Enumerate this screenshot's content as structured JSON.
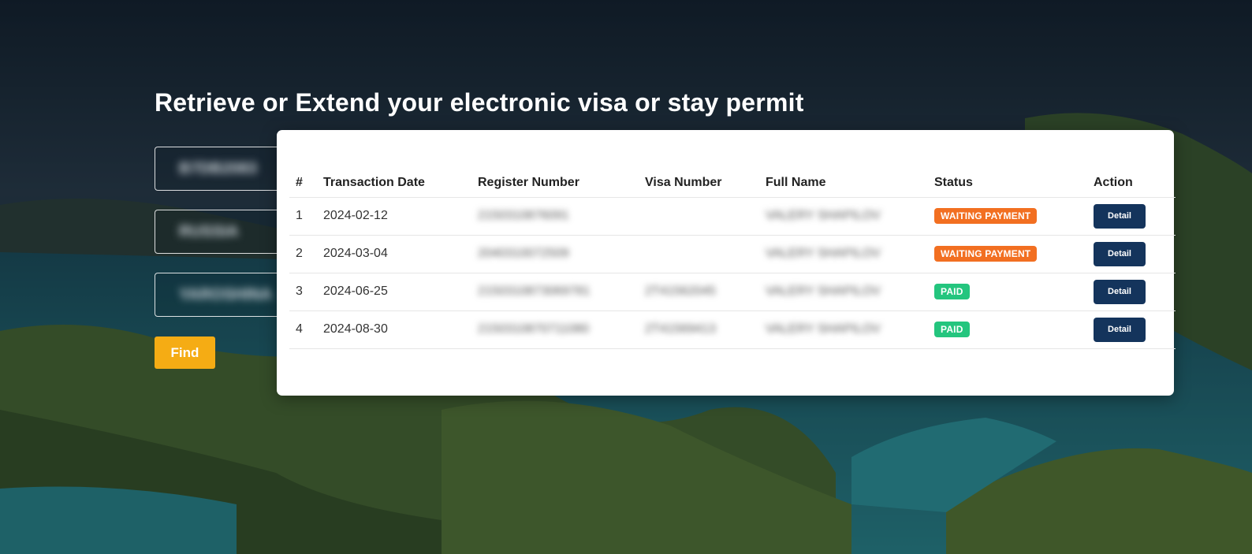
{
  "page": {
    "title": "Retrieve or Extend your electronic visa or stay permit"
  },
  "form": {
    "fields": [
      {
        "value": "B7DB2083"
      },
      {
        "value": "RUSSIA"
      },
      {
        "value": "YAROSHINA"
      }
    ],
    "find_label": "Find"
  },
  "table": {
    "headers": [
      "#",
      "Transaction Date",
      "Register Number",
      "Visa Number",
      "Full Name",
      "Status",
      "Action"
    ],
    "rows": [
      {
        "num": "1",
        "date": "2024-02-12",
        "register": "2150310876091",
        "visa": "",
        "name": "VALERY SHAPILOV",
        "status": "WAITING PAYMENT",
        "action": "Detail"
      },
      {
        "num": "2",
        "date": "2024-03-04",
        "register": "2040310072509",
        "visa": "",
        "name": "VALERY SHAPILOV",
        "status": "WAITING PAYMENT",
        "action": "Detail"
      },
      {
        "num": "3",
        "date": "2024-06-25",
        "register": "2150310873069781",
        "visa": "2T41562045",
        "name": "VALERY SHAPILOV",
        "status": "PAID",
        "action": "Detail"
      },
      {
        "num": "4",
        "date": "2024-08-30",
        "register": "2150310870711080",
        "visa": "2T41569413",
        "name": "VALERY SHAPILOV",
        "status": "PAID",
        "action": "Detail"
      }
    ]
  },
  "colors": {
    "waiting": "#f26f21",
    "paid": "#24c57e",
    "detail_button": "#14345c",
    "find_button": "#f5ac14"
  }
}
